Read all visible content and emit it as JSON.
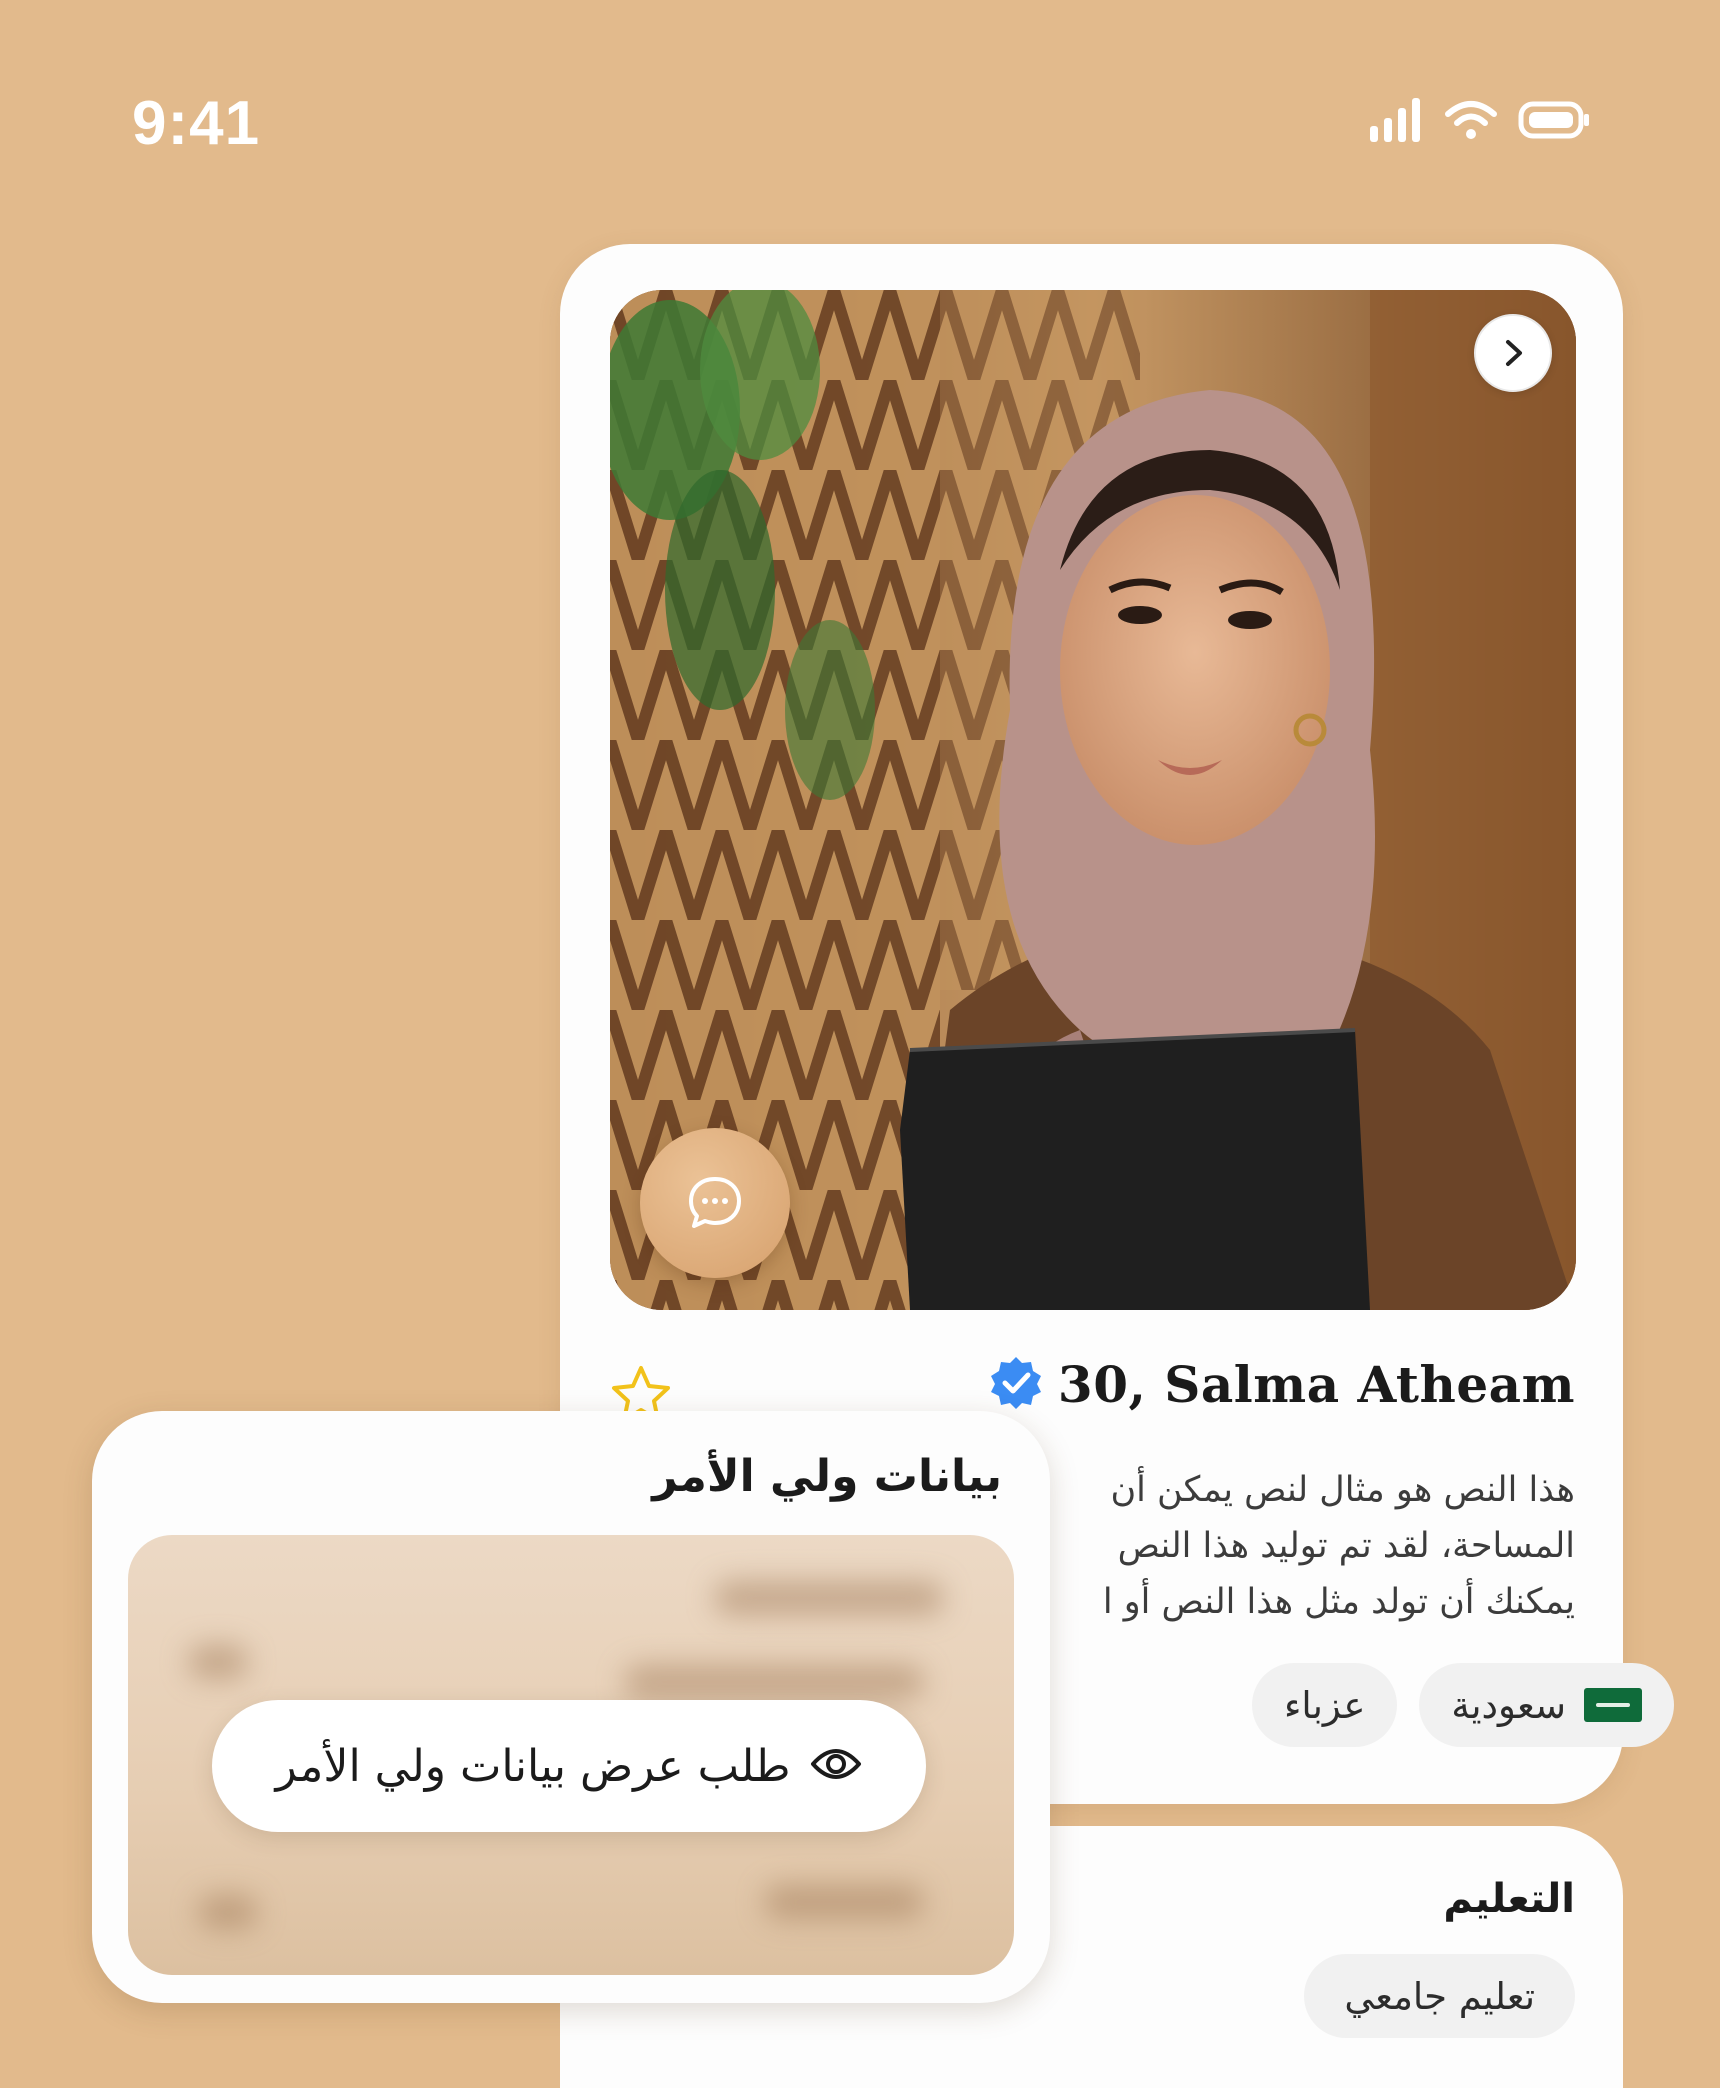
{
  "status_bar": {
    "time": "9:41"
  },
  "profile": {
    "name": "30, Salma Atheam",
    "bio_lines": [
      "هذا النص هو مثال لنص يمكن أن",
      "المساحة، لقد تم توليد هذا النص",
      "يمكنك أن تولد مثل هذا النص أو ا"
    ],
    "tags": [
      {
        "label": "سعودية",
        "icon": "saudi-flag-icon"
      },
      {
        "label": "عزباء"
      }
    ]
  },
  "education": {
    "title": "التعليم",
    "value": "تعليم جامعي"
  },
  "guardian": {
    "title": "بيانات ولي الأمر",
    "request_button": "طلب عرض بيانات ولي الأمر"
  },
  "icons": {
    "next": "chevron-right-icon",
    "chat": "chat-bubble-icon",
    "verified": "verified-badge-icon",
    "favorite": "star-outline-icon",
    "view": "eye-icon"
  },
  "colors": {
    "background": "#e2ba8c",
    "accent": "#d6a06c",
    "verified": "#3b8cf3",
    "star": "#f2c21b",
    "flag": "#0f6b3a"
  }
}
